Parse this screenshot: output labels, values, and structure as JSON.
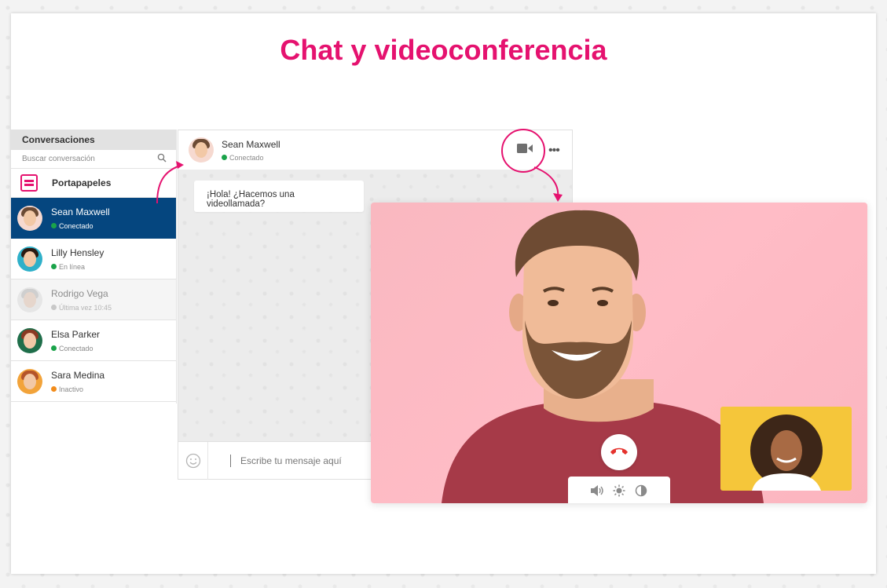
{
  "page": {
    "title": "Chat y videoconferencia"
  },
  "colors": {
    "accent": "#e5126f",
    "active_row": "#05467f",
    "online": "#1aa34a",
    "away": "#f28c1b",
    "offline": "#c8c8c8",
    "video_background": "#ffbcc6",
    "self_view_background": "#f5c63a",
    "hangup": "#e5322d"
  },
  "sidebar": {
    "header": "Conversaciones",
    "search_placeholder": "Buscar conversación",
    "clipboard_label": "Portapapeles",
    "contacts": [
      {
        "name": "Sean Maxwell",
        "status": "Conectado",
        "status_type": "online",
        "active": true
      },
      {
        "name": "Lilly Hensley",
        "status": "En línea",
        "status_type": "online",
        "active": false
      },
      {
        "name": "Rodrigo Vega",
        "status": "Última vez 10:45",
        "status_type": "offline",
        "active": false
      },
      {
        "name": "Elsa Parker",
        "status": "Conectado",
        "status_type": "online",
        "active": false
      },
      {
        "name": "Sara Medina",
        "status": "Inactivo",
        "status_type": "away",
        "active": false
      }
    ]
  },
  "chat": {
    "contact_name": "Sean Maxwell",
    "contact_status": "Conectado",
    "message": "¡Hola! ¿Hacemos una videollamada?",
    "composer_placeholder": "Escribe tu mensaje aquí",
    "icons": [
      "video-camera-icon",
      "more-options-icon",
      "emoji-icon"
    ]
  },
  "video_call": {
    "controls": [
      "hangup-icon",
      "volume-icon",
      "brightness-icon",
      "contrast-icon"
    ]
  }
}
